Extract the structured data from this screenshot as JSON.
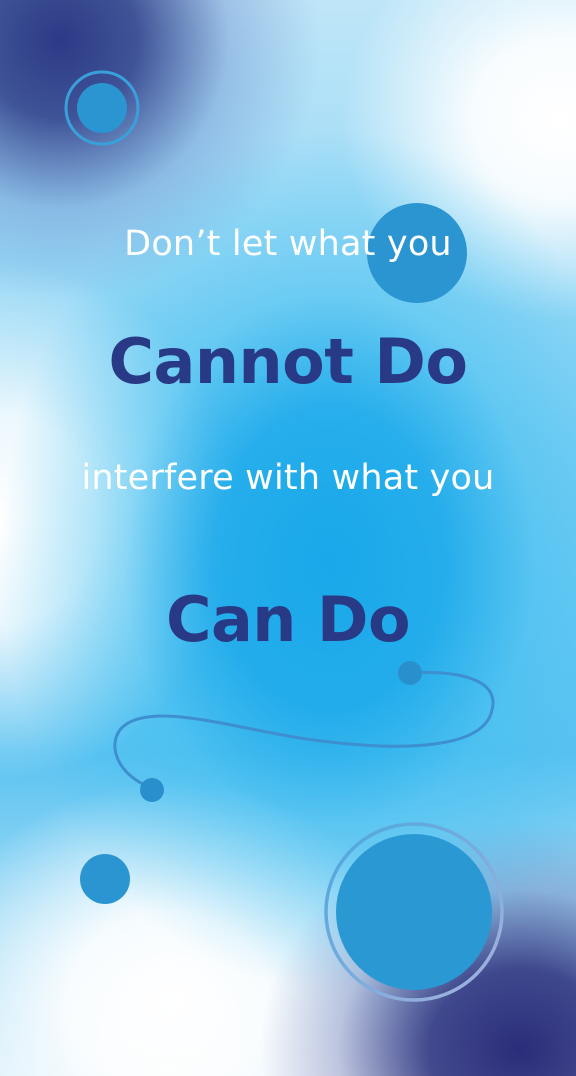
{
  "poster": {
    "line1": "Don’t let what you",
    "line2": "Cannot Do",
    "line3": "interfere with what you",
    "line4": "Can Do"
  },
  "colors": {
    "emphasis_text": "#283a85",
    "light_text": "#ffffff",
    "circle_fill": "#2a95d1",
    "ring_stroke": "#2a95d1"
  }
}
